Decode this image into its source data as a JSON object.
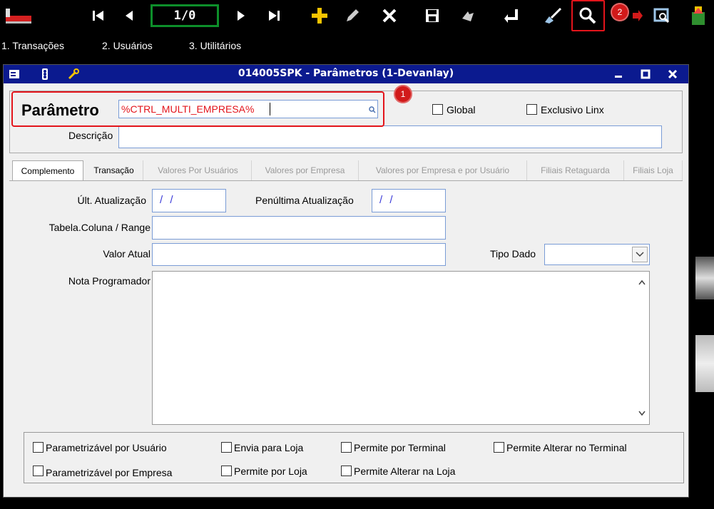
{
  "toolbar": {
    "record_counter": "1/0",
    "icons": [
      "app-logo-icon",
      "first-record-icon",
      "previous-record-icon",
      "next-record-icon",
      "last-record-icon",
      "add-icon",
      "edit-icon",
      "delete-icon",
      "save-icon",
      "refresh-icon",
      "confirm-icon",
      "clean-icon",
      "search-icon",
      "view-icon",
      "export-icon"
    ],
    "badge_2": "2"
  },
  "menu": {
    "items": [
      "1. Transações",
      "2. Usuários",
      "3. Utilitários"
    ]
  },
  "window": {
    "title": "014005SPK - Parâmetros (1-Devanlay)",
    "controls": [
      "minimize",
      "maximize",
      "close"
    ]
  },
  "form": {
    "parametro_label": "Parâmetro",
    "parametro_value": "%CTRL_MULTI_EMPRESA%",
    "badge_1": "1",
    "global_label": "Global",
    "exclusivo_label": "Exclusivo Linx",
    "descricao_label": "Descrição",
    "descricao_value": ""
  },
  "tabs": [
    {
      "label": "Complemento",
      "state": "active"
    },
    {
      "label": "Transação",
      "state": "enabled"
    },
    {
      "label": "Valores Por Usuários",
      "state": "disabled"
    },
    {
      "label": "Valores por Empresa",
      "state": "disabled"
    },
    {
      "label": "Valores por Empresa e por Usuário",
      "state": "disabled"
    },
    {
      "label": "Filiais Retaguarda",
      "state": "disabled"
    },
    {
      "label": "Filiais Loja",
      "state": "disabled"
    }
  ],
  "complemento": {
    "ult_atualizacao_label": "Últ. Atualização",
    "ult_atualizacao_value": "/ /",
    "penultima_label": "Penúltima Atualização",
    "penultima_value": "/ /",
    "tabela_label": "Tabela.Coluna / Range",
    "valor_atual_label": "Valor Atual",
    "tipo_dado_label": "Tipo Dado",
    "nota_label": "Nota Programador"
  },
  "options": {
    "items": [
      "Parametrizável por Usuário",
      "Envia para Loja",
      "Permite por Terminal",
      "Permite Alterar no Terminal",
      "Parametrizável por Empresa",
      "Permite por Loja",
      "Permite Alterar na Loja"
    ]
  },
  "colors": {
    "titlebar": "#0b1a8f",
    "highlight": "#e3141b",
    "counter_border": "#0d8f2a",
    "date_text": "#3a3ad8",
    "param_text": "#e3141b"
  }
}
